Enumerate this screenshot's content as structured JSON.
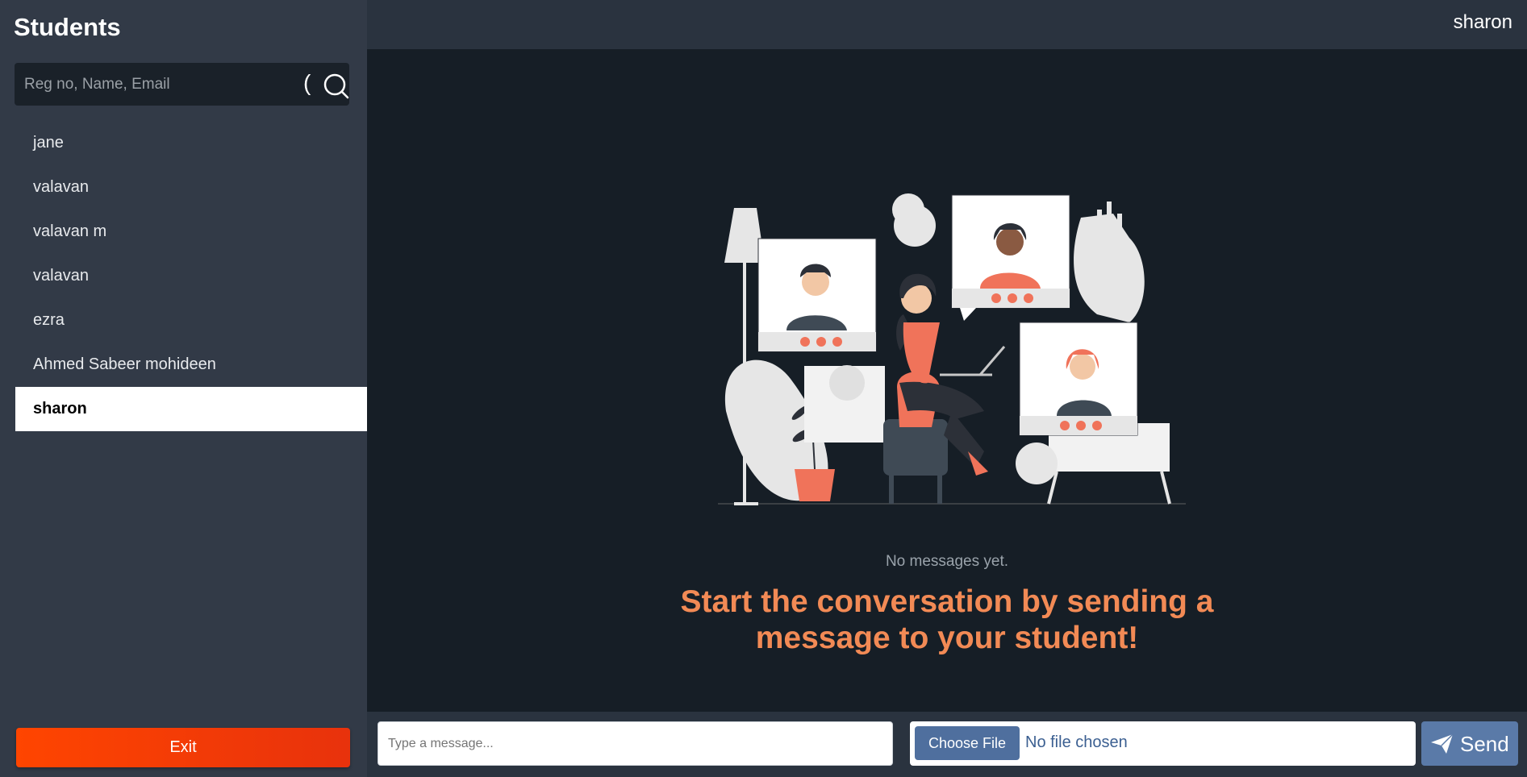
{
  "sidebar": {
    "title": "Students",
    "search_placeholder": "Reg no, Name, Email",
    "search_paren": "(",
    "students": [
      "jane",
      "valavan",
      "valavan m",
      "valavan",
      "ezra",
      "Ahmed Sabeer mohideen",
      "sharon"
    ],
    "active_index": 6,
    "exit_label": "Exit"
  },
  "header": {
    "current_user": "sharon"
  },
  "empty_state": {
    "subtitle": "No messages yet.",
    "headline_line1": "Start the conversation by sending a",
    "headline_line2": "message to your student!"
  },
  "composer": {
    "message_placeholder": "Type a message...",
    "file_button_label": "Choose File",
    "file_status": "No file chosen",
    "send_label": "Send"
  },
  "colors": {
    "sidebar_bg": "#323a47",
    "main_bg": "#161e26",
    "accent_orange": "#f28a55",
    "exit_red": "#ff4500",
    "send_blue": "#5a7aa8"
  }
}
